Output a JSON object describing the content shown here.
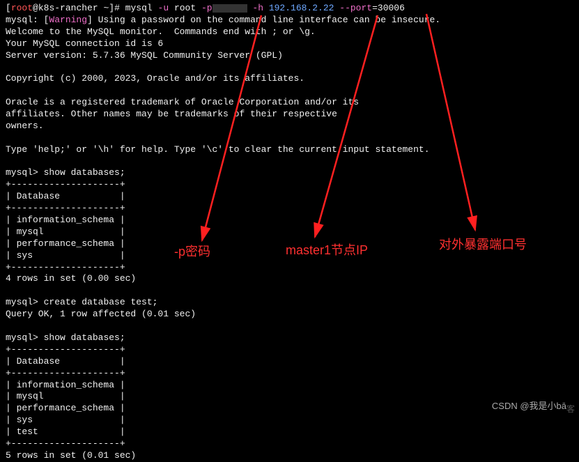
{
  "prompt_user": "root",
  "prompt_host": "k8s-rancher",
  "prompt_path": "~",
  "command": {
    "bin": "mysql",
    "user_flag": "-u",
    "user_val": "root",
    "pass_flag": "-p",
    "host_flag": "-h",
    "host_val": "192.168.2.22",
    "port_flag": "--port",
    "port_val": "30006"
  },
  "intro": {
    "warn_prefix": "mysql: [",
    "warn_word": "Warning",
    "warn_suffix": "] Using a password on the command line interface can be insecure.",
    "line1": "Welcome to the MySQL monitor.  Commands end with ; or \\g.",
    "line2": "Your MySQL connection id is 6",
    "line3": "Server version: 5.7.36 MySQL Community Server (GPL)",
    "copyright": "Copyright (c) 2000, 2023, Oracle and/or its affiliates.",
    "trademark1": "Oracle is a registered trademark of Oracle Corporation and/or its",
    "trademark2": "affiliates. Other names may be trademarks of their respective",
    "trademark3": "owners.",
    "help": "Type 'help;' or '\\h' for help. Type '\\c' to clear the current input statement."
  },
  "session": {
    "prompt": "mysql>",
    "cmd1": "show databases;",
    "divider": "+--------------------+",
    "header": "| Database           |",
    "rows1": [
      "| information_schema |",
      "| mysql              |",
      "| performance_schema |",
      "| sys                |"
    ],
    "result1": "4 rows in set (0.00 sec)",
    "cmd2": "create database test;",
    "result2": "Query OK, 1 row affected (0.01 sec)",
    "cmd3": "show databases;",
    "rows2": [
      "| information_schema |",
      "| mysql              |",
      "| performance_schema |",
      "| sys                |",
      "| test               |"
    ],
    "result3": "5 rows in set (0.01 sec)"
  },
  "annotations": {
    "password": "-p密码",
    "master_ip": "master1节点IP",
    "port": "对外暴露端口号"
  },
  "watermark": "CSDN @我是小bā",
  "watermark_sub": "客"
}
